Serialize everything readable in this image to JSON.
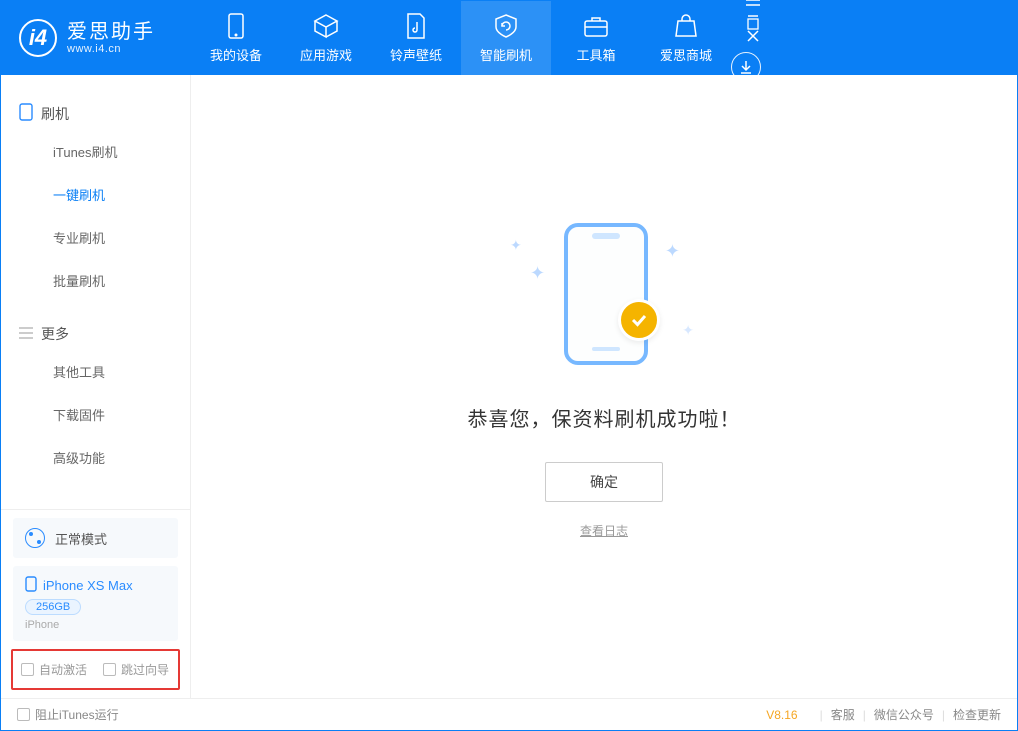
{
  "app": {
    "title": "爱思助手",
    "subtitle": "www.i4.cn"
  },
  "tabs": {
    "device": "我的设备",
    "apps": "应用游戏",
    "ringtone": "铃声壁纸",
    "flash": "智能刷机",
    "toolbox": "工具箱",
    "store": "爱思商城"
  },
  "sidebar": {
    "group_flash": "刷机",
    "itunes_flash": "iTunes刷机",
    "oneclick_flash": "一键刷机",
    "pro_flash": "专业刷机",
    "batch_flash": "批量刷机",
    "group_more": "更多",
    "other_tools": "其他工具",
    "download_fw": "下载固件",
    "advanced": "高级功能"
  },
  "mode": {
    "label": "正常模式"
  },
  "device": {
    "name": "iPhone XS Max",
    "capacity": "256GB",
    "type": "iPhone"
  },
  "checks": {
    "auto_activate": "自动激活",
    "skip_guide": "跳过向导"
  },
  "main": {
    "message": "恭喜您，保资料刷机成功啦！",
    "ok": "确定",
    "view_log": "查看日志"
  },
  "status": {
    "block_itunes": "阻止iTunes运行",
    "version": "V8.16",
    "support": "客服",
    "wechat": "微信公众号",
    "update": "检查更新"
  }
}
